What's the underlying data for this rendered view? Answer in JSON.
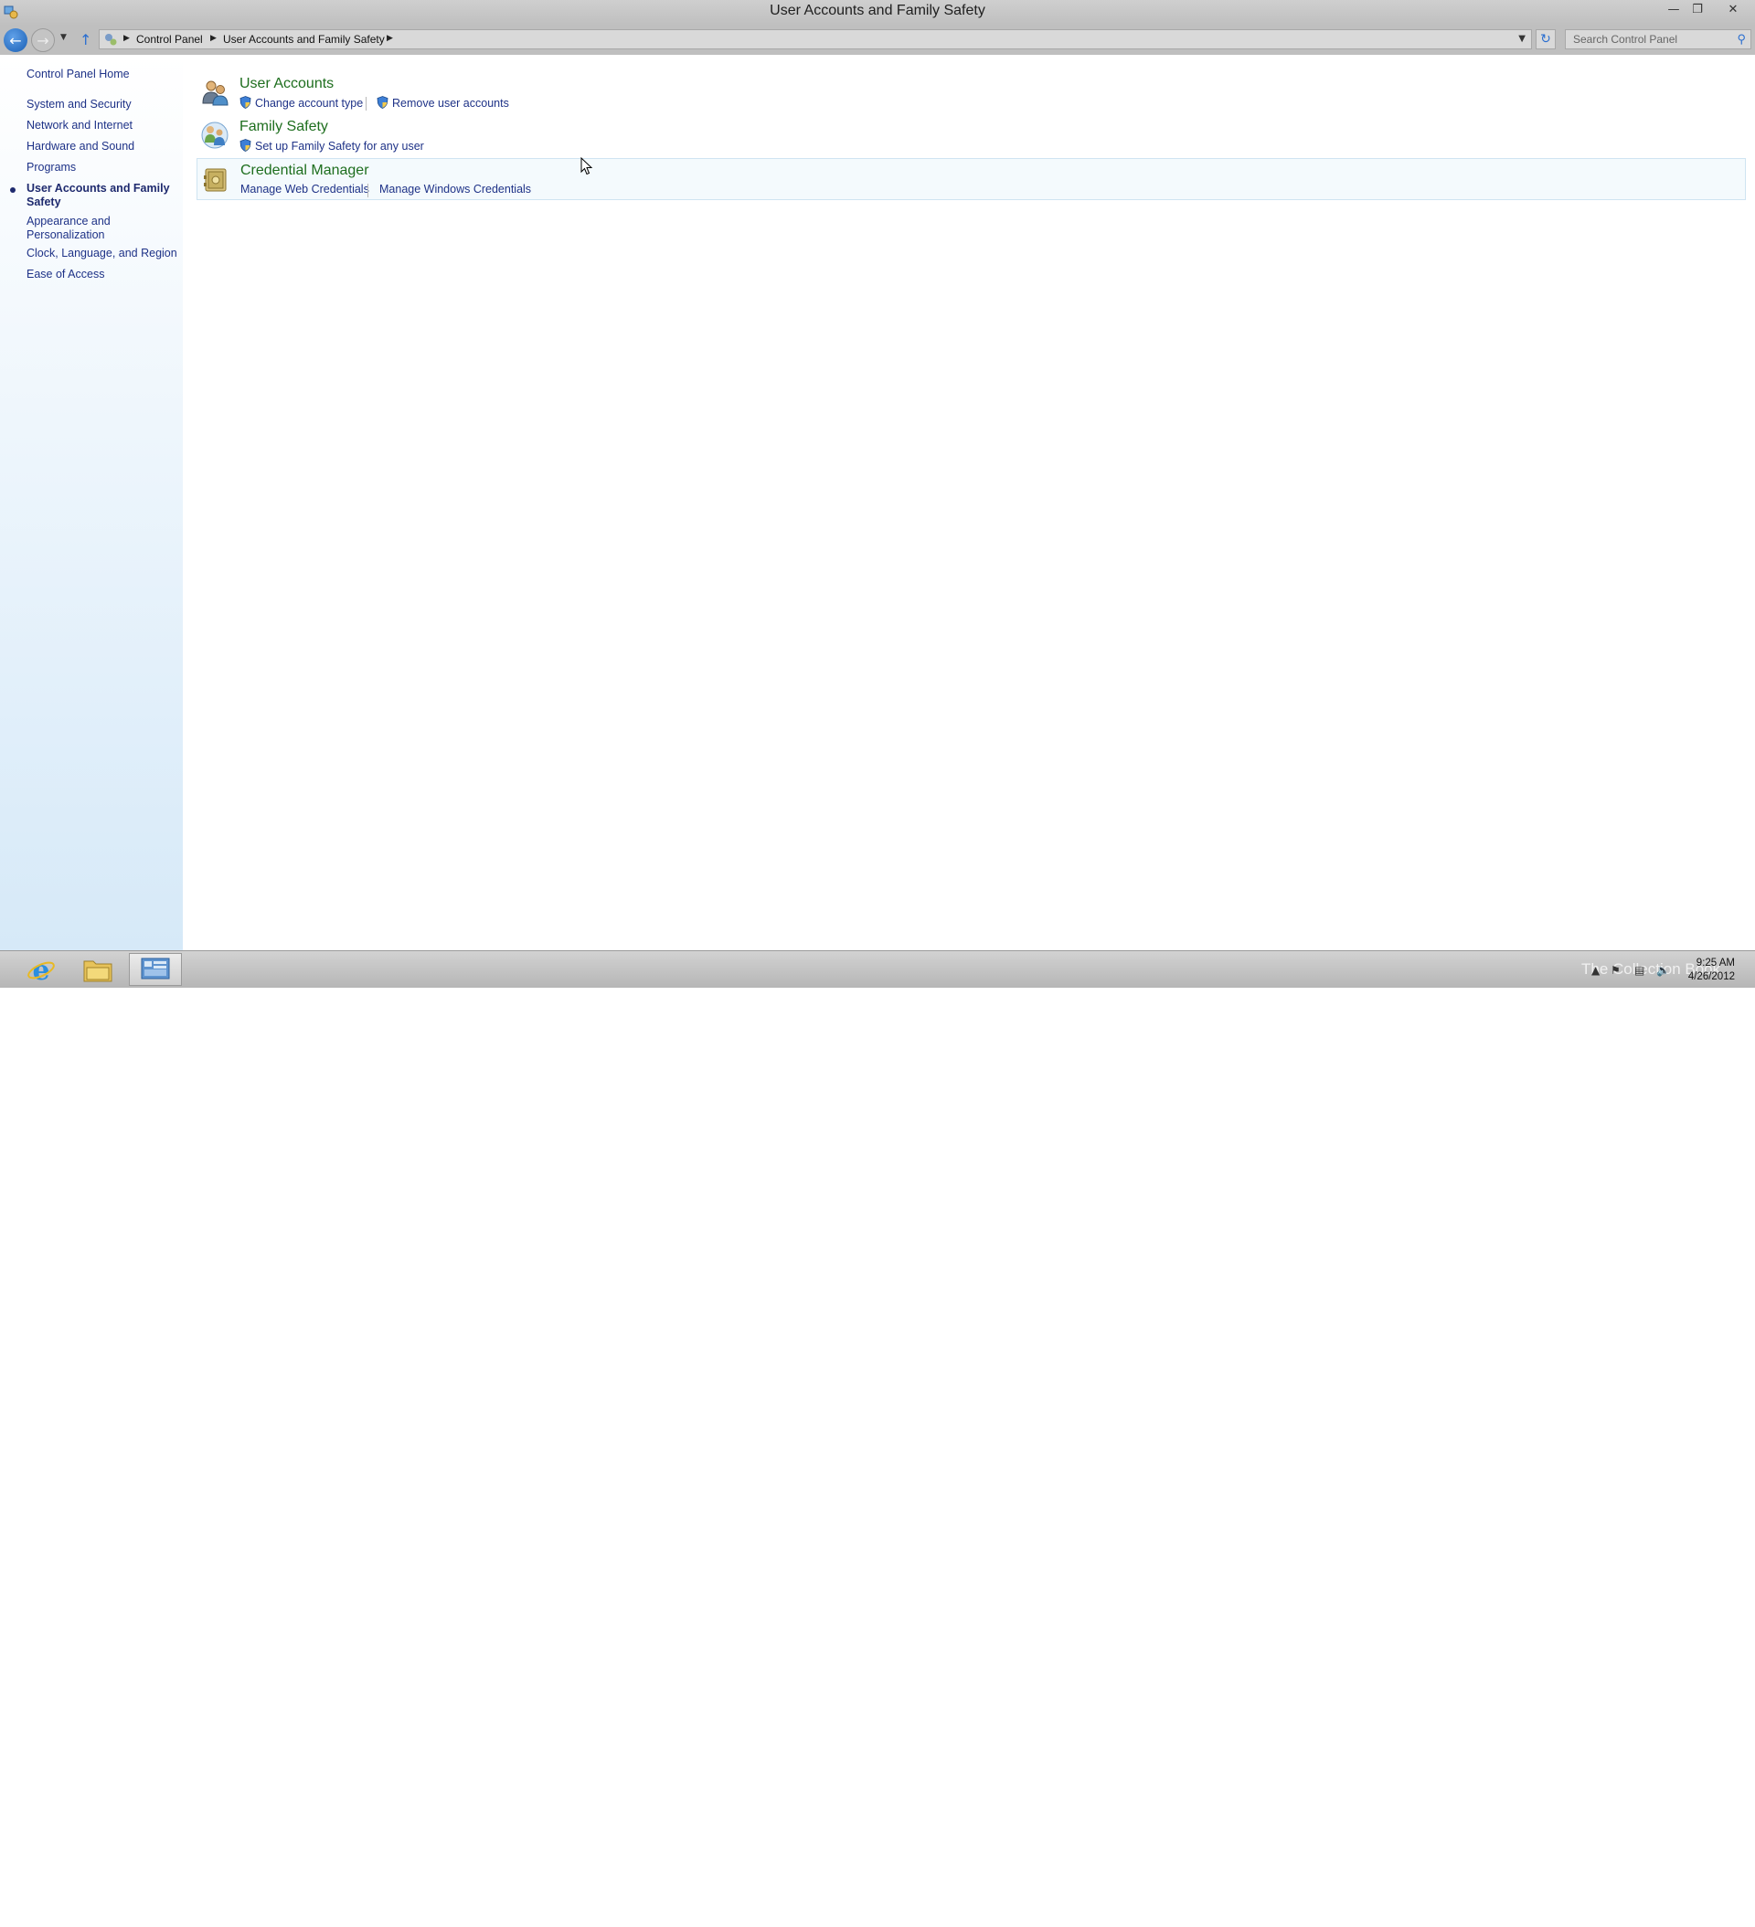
{
  "window": {
    "title": "User Accounts and Family Safety",
    "controls": [
      "minimize",
      "restore",
      "close"
    ]
  },
  "address_bar": {
    "breadcrumbs": [
      "Control Panel",
      "User Accounts and Family Safety"
    ],
    "search_placeholder": "Search Control Panel"
  },
  "sidebar": {
    "items": [
      {
        "label": "Control Panel Home"
      },
      {
        "label": "System and Security"
      },
      {
        "label": "Network and Internet"
      },
      {
        "label": "Hardware and Sound"
      },
      {
        "label": "Programs"
      },
      {
        "label": "User Accounts and Family Safety",
        "active": true
      },
      {
        "label": "Appearance and Personalization"
      },
      {
        "label": "Clock, Language, and Region"
      },
      {
        "label": "Ease of Access"
      }
    ]
  },
  "categories": [
    {
      "title": "User Accounts",
      "icon": "users-icon",
      "tasks": [
        {
          "label": "Change account type",
          "shield": true
        },
        {
          "label": "Remove user accounts",
          "shield": true
        }
      ]
    },
    {
      "title": "Family Safety",
      "icon": "family-icon",
      "tasks": [
        {
          "label": "Set up Family Safety for any user",
          "shield": true
        }
      ]
    },
    {
      "title": "Credential Manager",
      "icon": "vault-icon",
      "tasks": [
        {
          "label": "Manage Web Credentials",
          "shield": false
        },
        {
          "label": "Manage Windows Credentials",
          "shield": false
        }
      ]
    }
  ],
  "taskbar": {
    "apps": [
      "internet-explorer-icon",
      "file-explorer-icon",
      "control-panel-icon"
    ],
    "clock": {
      "time": "9:25 AM",
      "date": "4/26/2012"
    },
    "watermark": "The Collection Book"
  },
  "colors": {
    "link": "#1e3287",
    "category_title": "#1e6e1e",
    "sidebar_gradient_bottom": "#d6e9f8"
  }
}
